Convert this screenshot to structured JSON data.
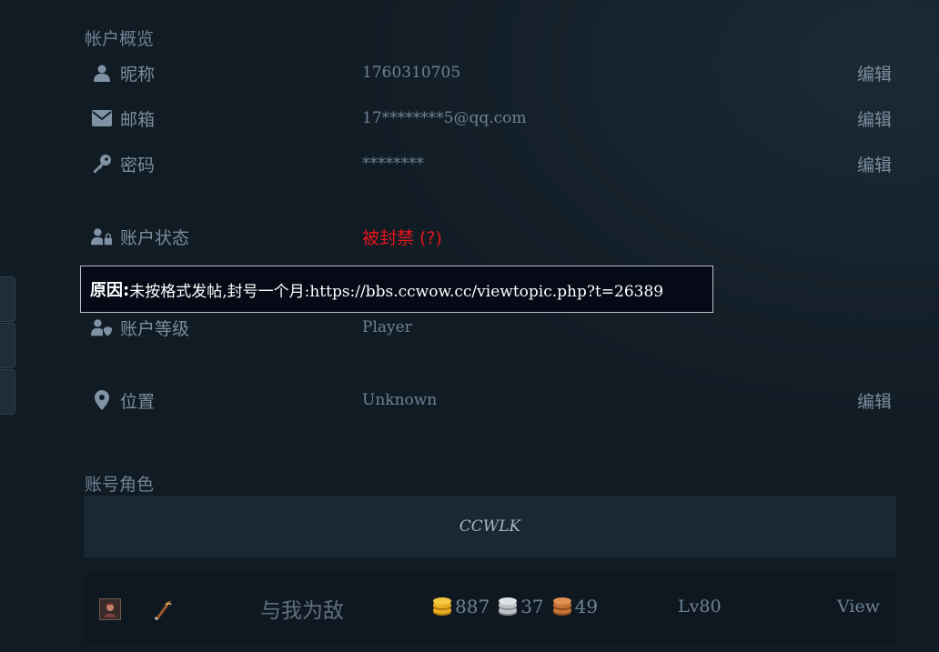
{
  "account_overview": {
    "title": "帐户概览",
    "nickname": {
      "label": "昵称",
      "value": "1760310705",
      "action": "编辑"
    },
    "email": {
      "label": "邮箱",
      "value": "17********5@qq.com",
      "action": "编辑"
    },
    "password": {
      "label": "密码",
      "value": "********",
      "action": "编辑"
    },
    "status": {
      "label": "账户状态",
      "value": "被封禁 (?)",
      "status_color": "#e3151b"
    },
    "level": {
      "label": "账户等级",
      "value": "Player"
    },
    "location": {
      "label": "位置",
      "value": "Unknown",
      "action": "编辑"
    }
  },
  "tooltip": {
    "label": "原因:",
    "text": " 未按格式发帖,封号一个月:https://bbs.ccwow.cc/viewtopic.php?t=26389"
  },
  "characters": {
    "title": "账号角色",
    "realm": "CCWLK",
    "list": [
      {
        "name": "与我为敌",
        "gold": "887",
        "silver": "37",
        "copper": "49",
        "level": "Lv80",
        "action": "View"
      }
    ]
  },
  "colors": {
    "background": "#111b24",
    "banned": "#e3151b",
    "gold": "#e8b020",
    "silver": "#c0c4c8",
    "copper": "#c8743a"
  }
}
